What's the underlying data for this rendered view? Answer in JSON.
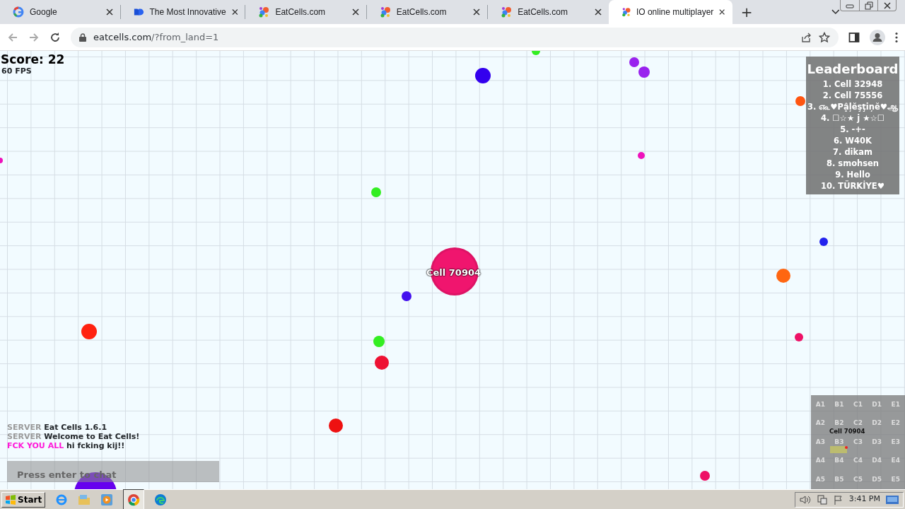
{
  "browser": {
    "tabs": [
      {
        "title": "Google",
        "kind": "google",
        "selected": false
      },
      {
        "title": "The Most Innovative",
        "kind": "brand",
        "selected": false
      },
      {
        "title": "EatCells.com",
        "kind": "eatcells",
        "selected": false
      },
      {
        "title": "EatCells.com",
        "kind": "eatcells",
        "selected": false
      },
      {
        "title": "EatCells.com",
        "kind": "eatcells",
        "selected": false
      },
      {
        "title": "IO online multiplayer",
        "kind": "eatcells",
        "selected": true
      }
    ],
    "new_tab": "+",
    "url": {
      "host": "eatcells.com",
      "path": "/?from_land=1"
    }
  },
  "game": {
    "score": "Score: 22",
    "fps": "60 FPS",
    "leaderboard": {
      "title": "Leaderboard",
      "entries": [
        "1. Cell 32948",
        "2. Cell 75556",
        "3. ௷♥Pậļĕşţiņĕ♥ஆ",
        "4. ☐☆★ j ★☆☐",
        "5. -+-",
        "6. W40K",
        "7. dikam",
        "8. smohsen",
        "9. Hello",
        "10. TÜRKİYE♥"
      ]
    },
    "player": {
      "name": "Cell 70904",
      "color": "#f0156e"
    },
    "cells": [
      {
        "color": "#33ee22"
      },
      {
        "color": "#3300ee"
      },
      {
        "color": "#9922ee"
      },
      {
        "color": "#9922ee"
      },
      {
        "color": "#ff5511"
      },
      {
        "color": "#ee11bb"
      },
      {
        "color": "#ee11bb"
      },
      {
        "color": "#33ee22"
      },
      {
        "color": "#2222ee"
      },
      {
        "color": "#ff6611"
      },
      {
        "color": "#4411ee"
      },
      {
        "color": "#ff2211"
      },
      {
        "color": "#33ee22"
      },
      {
        "color": "#ee1166"
      },
      {
        "color": "#ee1133"
      },
      {
        "color": "#ee1111"
      },
      {
        "color": "#ee1166"
      },
      {
        "color": "#6600ee"
      }
    ],
    "chat": {
      "messages": [
        {
          "sender": "SERVER",
          "text": "Eat Cells 1.6.1",
          "color": "#999999"
        },
        {
          "sender": "SERVER",
          "text": "Welcome to Eat Cells!",
          "color": "#999999"
        },
        {
          "sender": "FCK YOU ALL",
          "text": "hi fcking kij!!",
          "color": "#ff1ad9"
        }
      ],
      "placeholder": "Press enter to chat"
    },
    "minimap": {
      "sectors": [
        "A1",
        "B1",
        "C1",
        "D1",
        "E1",
        "A2",
        "B2",
        "C2",
        "D2",
        "E2",
        "A3",
        "B3",
        "C3",
        "D3",
        "E3",
        "A4",
        "B4",
        "C4",
        "D4",
        "E4",
        "A5",
        "B5",
        "C5",
        "D5",
        "E5"
      ],
      "player_label": "Cell 70904"
    }
  },
  "taskbar": {
    "start": "Start",
    "clock": "3:41 PM"
  }
}
